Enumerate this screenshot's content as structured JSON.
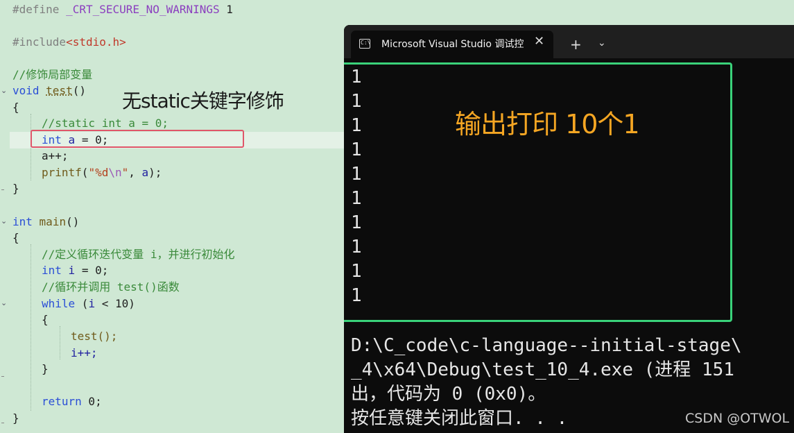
{
  "editor": {
    "define_kw": "#define",
    "define_macro": "_CRT_SECURE_NO_WARNINGS",
    "define_value": "1",
    "include_kw": "#include",
    "include_header": "<stdio.h>",
    "comment_local": "//修饰局部变量",
    "void_kw": "void",
    "test_fn": "test",
    "parens": "()",
    "brace_open": "{",
    "brace_close": "}",
    "comment_static": "//static int a = 0;",
    "int_kw": "int",
    "a_var": "a",
    "assign_zero": " = 0;",
    "a_incr": "a++;",
    "printf_fn": "printf",
    "printf_open": "(",
    "printf_str_start": "\"%d",
    "printf_esc": "\\n",
    "printf_str_end": "\"",
    "printf_rest": ", ",
    "printf_close": ");",
    "main_fn": "main",
    "comment_loop_var": "//定义循环迭代变量 i，并进行初始化",
    "i_var": "i",
    "comment_loop_call": "//循环并调用 test()函数",
    "while_kw": "while",
    "while_cond_open": " (",
    "while_cond_rest": " < 10)",
    "test_call": "test();",
    "i_incr": "i++;",
    "return_kw": "return",
    "return_rest": " 0;"
  },
  "annotations": {
    "no_static": "无static关键字修饰",
    "output_note": "输出打印 10个1"
  },
  "console": {
    "tab_title": "Microsoft Visual Studio 调试控",
    "tab_icon": "C:\\",
    "close_label": "✕",
    "new_tab_label": "+",
    "dropdown_label": "⌄",
    "output_lines": [
      "1",
      "1",
      "1",
      "1",
      "1",
      "1",
      "1",
      "1",
      "1",
      "1"
    ],
    "path_line1": "D:\\C_code\\c-language--initial-stage\\",
    "path_line2": "_4\\x64\\Debug\\test_10_4.exe (进程 151",
    "exit_line": "出，代码为 0 (0x0)。",
    "press_key_line": "按任意键关闭此窗口. . ."
  },
  "watermark": "CSDN @OTWOL",
  "colors": {
    "editor_bg": "#cfe8d4",
    "keyword": "#2b4fd6",
    "comment": "#3a8a3a",
    "console_bg": "#0c0c0c",
    "red_box": "#e0566a",
    "green_box": "#3ad27a",
    "annotation_orange": "#f5a623"
  }
}
